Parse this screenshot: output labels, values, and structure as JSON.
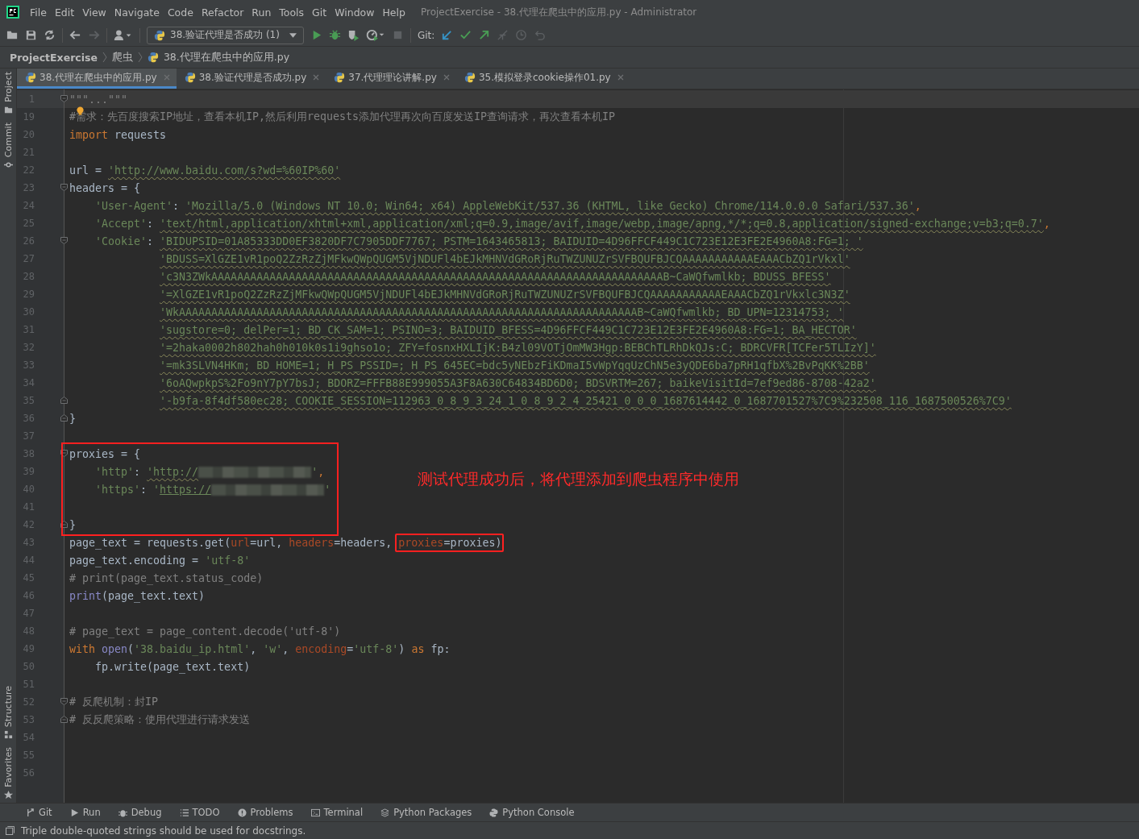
{
  "window": {
    "title": "ProjectExercise - 38.代理在爬虫中的应用.py - Administrator"
  },
  "menu": [
    "File",
    "Edit",
    "View",
    "Navigate",
    "Code",
    "Refactor",
    "Run",
    "Tools",
    "Git",
    "Window",
    "Help"
  ],
  "toolbar": {
    "run_config": "38.验证代理是否成功 (1)",
    "git_label": "Git:"
  },
  "breadcrumb": [
    "ProjectExercise",
    "爬虫",
    "38.代理在爬虫中的应用.py"
  ],
  "tabs": [
    {
      "label": "38.代理在爬虫中的应用.py",
      "selected": true
    },
    {
      "label": "38.验证代理是否成功.py",
      "selected": false
    },
    {
      "label": "37.代理理论讲解.py",
      "selected": false
    },
    {
      "label": "35.模拟登录cookie操作01.py",
      "selected": false
    }
  ],
  "side_tools_top": [
    "Project",
    "Commit"
  ],
  "side_tools_bottom": [
    "Structure",
    "Favorites"
  ],
  "code": {
    "note": "测试代理成功后，将代理添加到爬虫程序中使用",
    "sections": [
      {
        "boxed": false,
        "lines": [
          {
            "n": "1",
            "current": true,
            "fold_start": true,
            "tokens": [
              {
                "kind": "folded",
                "text": "\"\"\"...\"\"\""
              }
            ]
          },
          {
            "n": "19",
            "tokens": [
              {
                "kind": "comment",
                "text": "#"
              },
              {
                "kind": "bulb"
              },
              {
                "kind": "comment",
                "text": "需求：先百度搜索IP地址，查看本机IP,然后利用requests添加代理再次向百度发送IP查询请求，再次查看本机IP"
              }
            ]
          },
          {
            "n": "20",
            "tokens": [
              {
                "kind": "keyword",
                "text": "import"
              },
              {
                "kind": "text",
                "text": " requests"
              }
            ]
          },
          {
            "n": "21"
          },
          {
            "n": "22",
            "tokens": [
              {
                "kind": "text",
                "text": "url = "
              },
              {
                "kind": "string_warn",
                "text": "'http://www.baidu.com/s?wd=%60IP%60'"
              }
            ]
          },
          {
            "n": "23",
            "fold_start": true,
            "tokens": [
              {
                "kind": "text",
                "text": "headers = {"
              }
            ],
            "children": [
              {
                "n": "24",
                "tokens": [
                  {
                    "kind": "string",
                    "text": "'User-Agent'"
                  },
                  {
                    "kind": "text",
                    "text": ": "
                  },
                  {
                    "kind": "string_warn",
                    "text": "'Mozilla/5.0 (Windows NT 10.0; Win64; x64) AppleWebKit/537.36 (KHTML, like Gecko) Chrome/114.0.0.0 Safari/537.36'"
                  },
                  {
                    "kind": "keyword",
                    "text": ","
                  }
                ]
              },
              {
                "n": "25",
                "tokens": [
                  {
                    "kind": "string",
                    "text": "'Accept'"
                  },
                  {
                    "kind": "text",
                    "text": ": "
                  },
                  {
                    "kind": "string_warn",
                    "text": "'text/html,application/xhtml+xml,application/xml;q=0.9,image/avif,image/webp,image/apng,*/*;q=0.8,application/signed-exchange;v=b3;q=0.7'"
                  },
                  {
                    "kind": "keyword",
                    "text": ","
                  }
                ]
              },
              {
                "n": "26",
                "fold_start": true,
                "tokens": [
                  {
                    "kind": "string",
                    "text": "'Cookie'"
                  },
                  {
                    "kind": "text",
                    "text": ": "
                  },
                  {
                    "kind": "string_warn",
                    "text": "'BIDUPSID=01A85333DD0EF3820DF7C7905DDF7767; PSTM=1643465813; BAIDUID=4D96FFCF449C1C723E12E3FE2E4960A8:FG=1; '"
                  }
                ],
                "continued": [
                  {
                    "n": "27",
                    "tokens": [
                      {
                        "kind": "string_warn",
                        "text": "'BDUSS=XlGZE1vR1poQ2ZzRzZjMFkwQWpQUGM5VjNDUFl4bEJkMHNVdGRoRjRuTWZUNUZrSVFBQUFBJCQAAAAAAAAAAAEAAACbZQ1rVkxl'"
                      }
                    ]
                  },
                  {
                    "n": "28",
                    "tokens": [
                      {
                        "kind": "string_warn",
                        "text": "'c3N3ZWkAAAAAAAAAAAAAAAAAAAAAAAAAAAAAAAAAAAAAAAAAAAAAAAAAAAAAAAAAAAAAAAAAAAAAAB~CaWQfwmlkb; BDUSS_BFESS'"
                      }
                    ]
                  },
                  {
                    "n": "29",
                    "tokens": [
                      {
                        "kind": "string_warn",
                        "text": "'=XlGZE1vR1poQ2ZzRzZjMFkwQWpQUGM5VjNDUFl4bEJkMHNVdGRoRjRuTWZUNUZrSVFBQUFBJCQAAAAAAAAAAAEAAACbZQ1rVkxlc3N3Z'"
                      }
                    ]
                  },
                  {
                    "n": "30",
                    "tokens": [
                      {
                        "kind": "string_warn",
                        "text": "'WkAAAAAAAAAAAAAAAAAAAAAAAAAAAAAAAAAAAAAAAAAAAAAAAAAAAAAAAAAAAAAAAAAAAAAAAB~CaWQfwmlkb; BD_UPN=12314753; '"
                      }
                    ]
                  },
                  {
                    "n": "31",
                    "tokens": [
                      {
                        "kind": "string_warn",
                        "text": "'sugstore=0; delPer=1; BD_CK_SAM=1; PSINO=3; BAIDUID_BFESS=4D96FFCF449C1C723E12E3FE2E4960A8:FG=1; BA_HECTOR'"
                      }
                    ]
                  },
                  {
                    "n": "32",
                    "tokens": [
                      {
                        "kind": "string_warn",
                        "text": "'=2haka0002h802hah0h010k0s1i9ghso1o; ZFY=fosnxHXLIjK:B4zl09VOTjOmMW3Hgp:BEBChTLRhDkQJs:C; BDRCVFR[TCFer5TLIzY]'"
                      }
                    ]
                  },
                  {
                    "n": "33",
                    "tokens": [
                      {
                        "kind": "string_warn",
                        "text": "'=mk3SLVN4HKm; BD_HOME=1; H_PS_PSSID=; H_PS_645EC=bdc5yNEbzFiKDmaI5vWpYqqUzChN5e3yQDE6ba7pRH1qfbX%2BvPqKK%2BB'"
                      }
                    ]
                  },
                  {
                    "n": "34",
                    "tokens": [
                      {
                        "kind": "string_warn",
                        "text": "'6oAQwpkpS%2Fo9nY7pY7bsJ; BDORZ=FFFB88E999055A3F8A630C64834BD6D0; BDSVRTM=267; baikeVisitId=7ef9ed86-8708-42a2'"
                      }
                    ]
                  },
                  {
                    "n": "35",
                    "fold_end": true,
                    "tokens": [
                      {
                        "kind": "string_warn",
                        "text": "'-b9fa-8f4df580ec28; COOKIE_SESSION=112963_0_8_9_3_24_1_0_8_9_2_4_25421_0_0_0_1687614442_0_1687701527%7C9%232508_116_1687500526%7C9'"
                      }
                    ]
                  }
                ]
              }
            ]
          },
          {
            "n": "36",
            "fold_end": true,
            "tokens": [
              {
                "kind": "text",
                "text": "}"
              }
            ]
          },
          {
            "n": "37"
          }
        ]
      },
      {
        "boxed": true,
        "lines": [
          {
            "n": "38",
            "fold_start": true,
            "tokens": [
              {
                "kind": "text",
                "text": "proxies = {"
              }
            ],
            "children": [
              {
                "n": "39",
                "tokens": [
                  {
                    "kind": "string",
                    "text": "'http'"
                  },
                  {
                    "kind": "text",
                    "text": ": "
                  },
                  {
                    "kind": "string_warn",
                    "text": "'http://"
                  },
                  {
                    "kind": "redacted"
                  },
                  {
                    "kind": "string",
                    "text": "'"
                  },
                  {
                    "kind": "keyword",
                    "text": ","
                  }
                ]
              },
              {
                "n": "40",
                "tokens": [
                  {
                    "kind": "string",
                    "text": "'https'"
                  },
                  {
                    "kind": "text",
                    "text": ": "
                  },
                  {
                    "kind": "string",
                    "text": "'"
                  },
                  {
                    "kind": "link",
                    "text": "https://"
                  },
                  {
                    "kind": "redacted"
                  },
                  {
                    "kind": "string",
                    "text": "'"
                  }
                ]
              }
            ]
          },
          {
            "n": "41"
          },
          {
            "n": "42",
            "fold_end": true,
            "tokens": [
              {
                "kind": "text",
                "text": "}"
              }
            ]
          }
        ]
      },
      {
        "boxed": false,
        "lines": [
          {
            "n": "43",
            "tokens": [
              {
                "kind": "text",
                "text": "page_text = requests.get("
              },
              {
                "kind": "param",
                "text": "url"
              },
              {
                "kind": "text",
                "text": "=url, "
              },
              {
                "kind": "param",
                "text": "headers"
              },
              {
                "kind": "text",
                "text": "=headers, "
              },
              {
                "kind": "box",
                "tokens": [
                  {
                    "kind": "param",
                    "text": "proxies"
                  },
                  {
                    "kind": "text",
                    "text": "=proxies)"
                  }
                ]
              }
            ]
          },
          {
            "n": "44",
            "tokens": [
              {
                "kind": "text",
                "text": "page_text.encoding = "
              },
              {
                "kind": "string",
                "text": "'utf-8'"
              }
            ]
          },
          {
            "n": "45",
            "tokens": [
              {
                "kind": "comment",
                "text": "# print(page_text.status_code)"
              }
            ]
          },
          {
            "n": "46",
            "tokens": [
              {
                "kind": "builtin",
                "text": "print"
              },
              {
                "kind": "text",
                "text": "(page_text.text)"
              }
            ]
          },
          {
            "n": "47"
          },
          {
            "n": "48",
            "tokens": [
              {
                "kind": "comment",
                "text": "# page_text = page_content.decode('utf-8')"
              }
            ]
          },
          {
            "n": "49",
            "tokens": [
              {
                "kind": "keyword",
                "text": "with "
              },
              {
                "kind": "builtin",
                "text": "open"
              },
              {
                "kind": "text",
                "text": "("
              },
              {
                "kind": "string",
                "text": "'38.baidu_ip.html'"
              },
              {
                "kind": "text",
                "text": ", "
              },
              {
                "kind": "string",
                "text": "'w'"
              },
              {
                "kind": "text",
                "text": ", "
              },
              {
                "kind": "param",
                "text": "encoding"
              },
              {
                "kind": "text",
                "text": "="
              },
              {
                "kind": "string",
                "text": "'utf-8'"
              },
              {
                "kind": "text",
                "text": ") "
              },
              {
                "kind": "keyword",
                "text": "as"
              },
              {
                "kind": "text",
                "text": " fp:"
              }
            ],
            "children": [
              {
                "n": "50",
                "tokens": [
                  {
                    "kind": "text",
                    "text": "fp.write(page_text.text)"
                  }
                ]
              }
            ]
          },
          {
            "n": "51"
          },
          {
            "n": "52",
            "fold_start": true,
            "tokens": [
              {
                "kind": "comment",
                "text": "# 反爬机制：封IP"
              }
            ]
          },
          {
            "n": "53",
            "fold_end": true,
            "tokens": [
              {
                "kind": "comment",
                "text": "# 反反爬策略：使用代理进行请求发送"
              }
            ]
          },
          {
            "n": "54"
          },
          {
            "n": "55"
          },
          {
            "n": "56"
          }
        ]
      }
    ]
  },
  "tool_windows": [
    "Git",
    "Run",
    "Debug",
    "TODO",
    "Problems",
    "Terminal",
    "Python Packages",
    "Python Console"
  ],
  "status": "Triple double-quoted strings should be used for docstrings."
}
